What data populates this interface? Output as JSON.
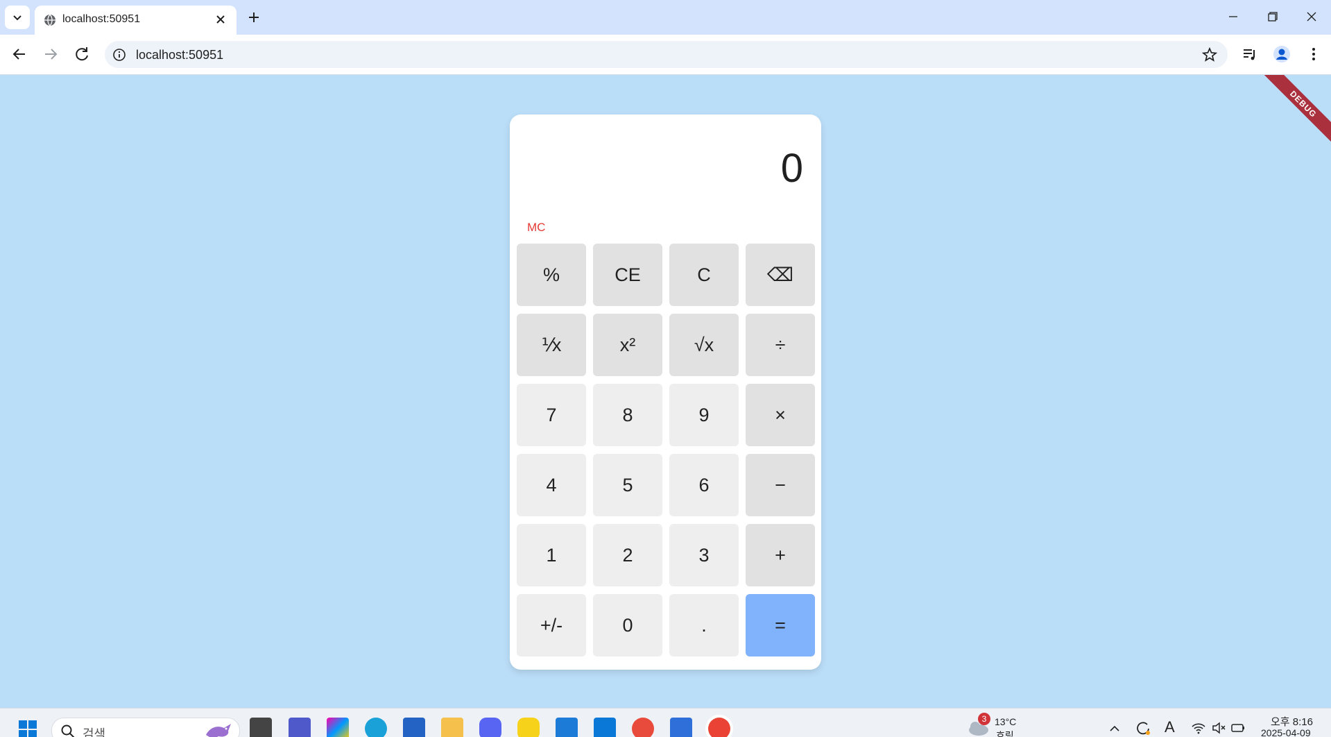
{
  "browser": {
    "tab_title": "localhost:50951",
    "url": "localhost:50951"
  },
  "page": {
    "debug_banner": "DEBUG"
  },
  "calculator": {
    "display_value": "0",
    "memory_button": "MC",
    "keys": [
      [
        "%",
        "CE",
        "C",
        "⌫"
      ],
      [
        "⅟x",
        "x²",
        "√x",
        "÷"
      ],
      [
        "7",
        "8",
        "9",
        "×"
      ],
      [
        "4",
        "5",
        "6",
        "−"
      ],
      [
        "1",
        "2",
        "3",
        "+"
      ],
      [
        "+/-",
        "0",
        ".",
        "="
      ]
    ],
    "colors": {
      "function_key": "#e1e1e1",
      "number_key": "#eeeeee",
      "equals_key": "#80b3fb",
      "memory_text": "#e53935"
    }
  },
  "taskbar": {
    "search_placeholder": "검색",
    "weather_badge": "3",
    "weather_temp": "13°C",
    "weather_desc": "흐림",
    "time": "오후 8:16",
    "date": "2025-04-09"
  }
}
